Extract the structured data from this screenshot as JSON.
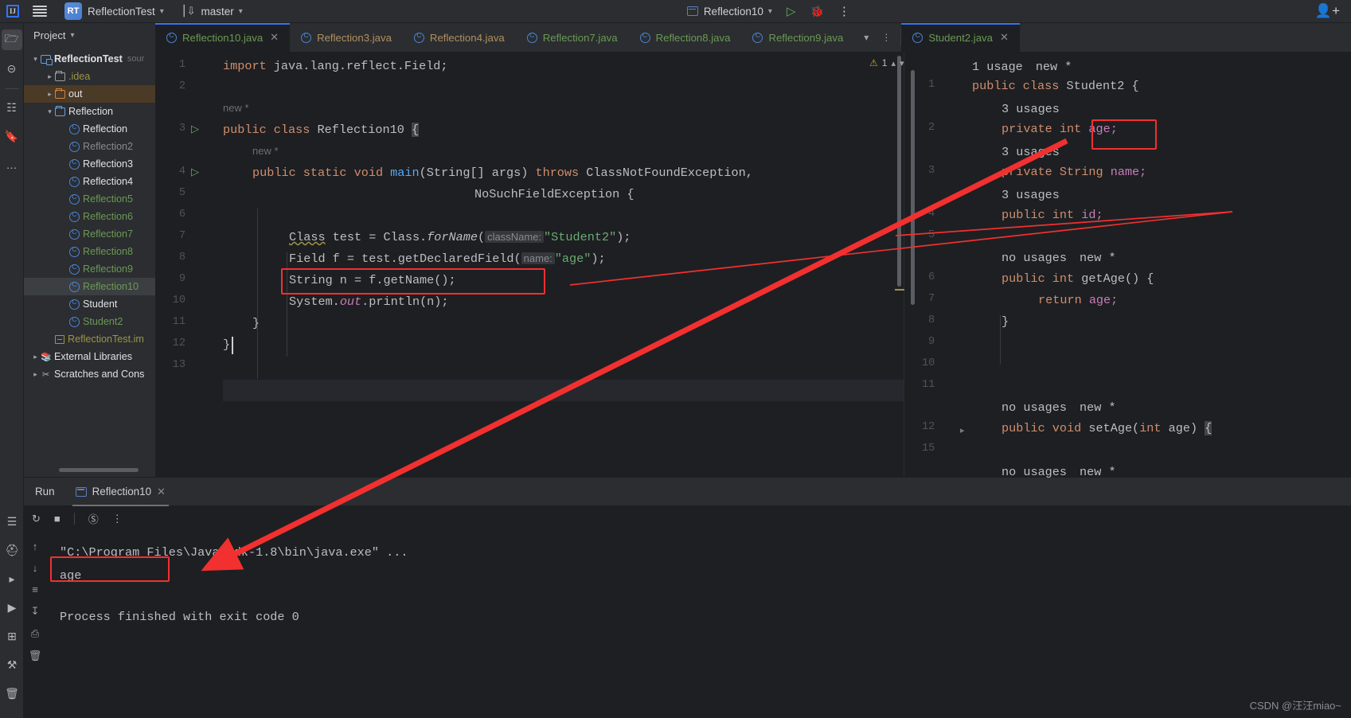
{
  "toolbar": {
    "logo": "IJ",
    "menu_icon": "hamburger-icon",
    "project_badge": "RT",
    "project_name": "ReflectionTest",
    "branch_icon": "git-branch-icon",
    "branch_name": "master",
    "run_config": "Reflection10",
    "run_icon": "run-icon",
    "debug_icon": "debug-icon",
    "more_icon": "more-vertical-icon",
    "account_icon": "add-user-icon"
  },
  "left_rail": {
    "items": [
      {
        "name": "project-tool-icon",
        "glyph": "🗀",
        "active": true
      },
      {
        "name": "commit-tool-icon",
        "glyph": "⊖",
        "active": false
      },
      {
        "name": "structure-tool-icon",
        "glyph": "⌗",
        "active": false
      },
      {
        "name": "bookmarks-tool-icon",
        "glyph": "🔖",
        "active": false
      },
      {
        "name": "more-tools-icon",
        "glyph": "…",
        "active": false
      }
    ],
    "bottom_items": [
      {
        "name": "todo-tool-icon",
        "glyph": "☰"
      },
      {
        "name": "problems-tool-icon",
        "glyph": "ⓧ"
      },
      {
        "name": "services-tool-icon",
        "glyph": "▷"
      },
      {
        "name": "run-tool-icon",
        "glyph": "▶"
      },
      {
        "name": "terminal-tool-icon",
        "glyph": "⌸"
      },
      {
        "name": "build-tool-icon",
        "glyph": "🔨"
      },
      {
        "name": "delete-tool-icon",
        "glyph": "🗑"
      }
    ]
  },
  "project": {
    "title": "Project",
    "tree": [
      {
        "depth": 0,
        "arrow": "v",
        "icon": "module-icon",
        "label": "ReflectionTest",
        "style": "bold",
        "suffix": "sour",
        "row": "plain"
      },
      {
        "depth": 1,
        "arrow": ">",
        "icon": "folder-grey-icon",
        "label": ".idea",
        "style": "olive",
        "suffix": "",
        "row": "plain"
      },
      {
        "depth": 1,
        "arrow": ">",
        "icon": "folder-orange-icon",
        "label": "out",
        "style": "white",
        "suffix": "",
        "row": "sel-out"
      },
      {
        "depth": 1,
        "arrow": "v",
        "icon": "folder-blue-icon",
        "label": "Reflection",
        "style": "white",
        "suffix": "",
        "row": "plain"
      },
      {
        "depth": 2,
        "arrow": "",
        "icon": "java-class-icon",
        "label": "Reflection",
        "style": "white",
        "suffix": "",
        "row": "plain"
      },
      {
        "depth": 2,
        "arrow": "",
        "icon": "java-class-icon",
        "label": "Reflection2",
        "style": "grey",
        "suffix": "",
        "row": "plain"
      },
      {
        "depth": 2,
        "arrow": "",
        "icon": "java-class-icon",
        "label": "Reflection3",
        "style": "white",
        "suffix": "",
        "row": "plain"
      },
      {
        "depth": 2,
        "arrow": "",
        "icon": "java-class-icon",
        "label": "Reflection4",
        "style": "white",
        "suffix": "",
        "row": "plain"
      },
      {
        "depth": 2,
        "arrow": "",
        "icon": "java-class-icon",
        "label": "Reflection5",
        "style": "green",
        "suffix": "",
        "row": "plain"
      },
      {
        "depth": 2,
        "arrow": "",
        "icon": "java-class-icon",
        "label": "Reflection6",
        "style": "green",
        "suffix": "",
        "row": "plain"
      },
      {
        "depth": 2,
        "arrow": "",
        "icon": "java-class-icon",
        "label": "Reflection7",
        "style": "green",
        "suffix": "",
        "row": "plain"
      },
      {
        "depth": 2,
        "arrow": "",
        "icon": "java-class-icon",
        "label": "Reflection8",
        "style": "green",
        "suffix": "",
        "row": "plain"
      },
      {
        "depth": 2,
        "arrow": "",
        "icon": "java-class-icon",
        "label": "Reflection9",
        "style": "green",
        "suffix": "",
        "row": "plain"
      },
      {
        "depth": 2,
        "arrow": "",
        "icon": "java-class-icon",
        "label": "Reflection10",
        "style": "green",
        "suffix": "",
        "row": "sel-file"
      },
      {
        "depth": 2,
        "arrow": "",
        "icon": "java-class-icon",
        "label": "Student",
        "style": "white",
        "suffix": "",
        "row": "plain"
      },
      {
        "depth": 2,
        "arrow": "",
        "icon": "java-class-icon",
        "label": "Student2",
        "style": "green",
        "suffix": "",
        "row": "plain"
      },
      {
        "depth": 1,
        "arrow": "",
        "icon": "iml-file-icon",
        "label": "ReflectionTest.im",
        "style": "olive",
        "suffix": "",
        "row": "plain"
      },
      {
        "depth": 0,
        "arrow": ">",
        "icon": "library-icon",
        "label": "External Libraries",
        "style": "white",
        "suffix": "",
        "row": "plain"
      },
      {
        "depth": 0,
        "arrow": ">",
        "icon": "scratch-icon",
        "label": "Scratches and Cons",
        "style": "white",
        "suffix": "",
        "row": "plain"
      }
    ]
  },
  "editor_tabs": {
    "left": [
      {
        "label": "Reflection10.java",
        "color": "green",
        "active": true,
        "closable": true
      },
      {
        "label": "Reflection3.java",
        "color": "orange",
        "active": false,
        "closable": false
      },
      {
        "label": "Reflection4.java",
        "color": "orange",
        "active": false,
        "closable": false
      },
      {
        "label": "Reflection7.java",
        "color": "green",
        "active": false,
        "closable": false
      },
      {
        "label": "Reflection8.java",
        "color": "green",
        "active": false,
        "closable": false
      },
      {
        "label": "Reflection9.java",
        "color": "green",
        "active": false,
        "closable": false
      }
    ],
    "overflow_icon": "chevron-down-icon",
    "options_icon": "more-vertical-icon",
    "right": [
      {
        "label": "Student2.java",
        "color": "green",
        "active": true,
        "closable": true
      }
    ]
  },
  "editor_left": {
    "warnings_count": "1",
    "lines": [
      {
        "num": "1",
        "run": false
      },
      {
        "num": "2",
        "run": false
      },
      {
        "num": "3",
        "run": true
      },
      {
        "num": "4",
        "run": true
      },
      {
        "num": "5",
        "run": false
      },
      {
        "num": "6",
        "run": false
      },
      {
        "num": "7",
        "run": false
      },
      {
        "num": "8",
        "run": false
      },
      {
        "num": "9",
        "run": false
      },
      {
        "num": "10",
        "run": false
      },
      {
        "num": "11",
        "run": false
      },
      {
        "num": "12",
        "run": false
      },
      {
        "num": "13",
        "run": false
      }
    ],
    "code": {
      "import_kw": "import",
      "import_pkg": " java.lang.reflect.Field;",
      "hint_new_1": "new *",
      "hint_new_2": "new *",
      "class_decl_kw": "public class ",
      "class_decl_name": "Reflection10 ",
      "class_decl_brace": "{",
      "main_kw1": "public static void ",
      "main_name": "main",
      "main_sig": "(String[] args) ",
      "main_throws": "throws",
      "main_exc1": " ClassNotFoundException,",
      "main_exc2": "NoSuchFieldException {",
      "l7_a": "Class",
      "l7_b": " test = Class.",
      "l7_c": "forName",
      "l7_d": "(",
      "l7_hint": "className:",
      "l7_str": "\"Student2\"",
      "l7_e": ");",
      "l8_a": "Field f = test.getDeclaredField(",
      "l8_hint": "name:",
      "l8_str": "\"age\"",
      "l8_e": ");",
      "l9": "String n = f.getName();",
      "l10_a": "System.",
      "l10_out": "out",
      "l10_b": ".println(n);",
      "l11": "}",
      "l12": "}"
    }
  },
  "editor_right": {
    "lines": [
      "1",
      "2",
      "3",
      "4",
      "5",
      "6",
      "7",
      "8",
      "9",
      "10",
      "11",
      "12",
      "15"
    ],
    "code": {
      "h1_usage": "1 usage",
      "h1_new": "new *",
      "class_kw": "public class ",
      "class_name": "Student2 {",
      "u_age": "3 usages",
      "age_kw": "private int ",
      "age_fld": "age;",
      "u_name": "3 usages",
      "name_kw": "private String ",
      "name_fld": "name;",
      "u_id": "3 usages",
      "id_kw": "public int ",
      "id_fld": "id;",
      "u_getage": "no usages",
      "n_getage": "new *",
      "getage_kw": "public int ",
      "getage_name": "getAge() {",
      "ret_kw": "return ",
      "ret_fld": "age;",
      "close_brace": "}",
      "u_setage": "no usages",
      "n_setage": "new *",
      "setage_kw": "public void ",
      "setage_name": "setAge(",
      "setage_kw2": "int",
      "setage_param": " age) ",
      "setage_brace": "{",
      "u_last": "no usages",
      "n_last": "new *"
    }
  },
  "run_panel": {
    "title": "Run",
    "tab_label": "Reflection10",
    "tab_icon": "run-config-icon",
    "close_icon": "close-icon",
    "toolbar": [
      {
        "name": "rerun-icon",
        "glyph": "↻"
      },
      {
        "name": "stop-icon",
        "glyph": "■"
      },
      {
        "name": "filter-icon",
        "glyph": "⊘"
      },
      {
        "name": "more-vertical-icon",
        "glyph": "⋮"
      }
    ],
    "rail": [
      {
        "name": "scroll-up-icon",
        "glyph": "↑"
      },
      {
        "name": "scroll-down-icon",
        "glyph": "↓"
      },
      {
        "name": "soft-wrap-icon",
        "glyph": "≡"
      },
      {
        "name": "scroll-end-icon",
        "glyph": "↧"
      },
      {
        "name": "print-icon",
        "glyph": "⎙"
      },
      {
        "name": "clear-icon",
        "glyph": "🗑"
      }
    ],
    "console": {
      "cmd": "\"C:\\Program Files\\Java\\jdk-1.8\\bin\\java.exe\" ...",
      "output": "age",
      "exit": "Process finished with exit code 0"
    }
  },
  "watermark": "CSDN @汪汪miao~",
  "colors": {
    "accent": "#3573f0",
    "annotation_red": "#f23030",
    "keyword": "#cf8e6d",
    "string": "#6aab73",
    "method": "#56a8f5",
    "field": "#c77dbb",
    "comment_grey": "#6b6f76"
  }
}
